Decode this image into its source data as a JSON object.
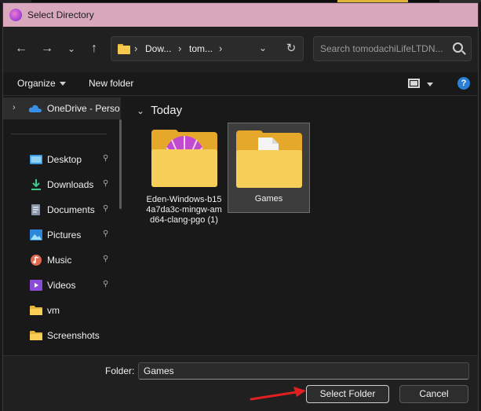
{
  "window": {
    "title": "Select Directory"
  },
  "nav": {
    "breadcrumb": [
      "Dow...",
      "tom..."
    ],
    "search_placeholder": "Search tomodachiLifeLTDN..."
  },
  "toolbar": {
    "organize": "Organize",
    "new_folder": "New folder",
    "help": "?"
  },
  "sidebar": {
    "items": [
      {
        "label": "OneDrive - Perso",
        "icon": "cloud-icon"
      },
      {
        "label": "Desktop",
        "icon": "desktop-icon",
        "pinned": true
      },
      {
        "label": "Downloads",
        "icon": "download-icon",
        "pinned": true
      },
      {
        "label": "Documents",
        "icon": "document-icon",
        "pinned": true
      },
      {
        "label": "Pictures",
        "icon": "picture-icon",
        "pinned": true
      },
      {
        "label": "Music",
        "icon": "music-icon",
        "pinned": true
      },
      {
        "label": "Videos",
        "icon": "video-icon",
        "pinned": true
      },
      {
        "label": "vm",
        "icon": "folder-icon"
      },
      {
        "label": "Screenshots",
        "icon": "folder-icon"
      }
    ]
  },
  "content": {
    "group": "Today",
    "items": [
      {
        "name": "Eden-Windows-b154a7da3c-mingw-amd64-clang-pgo (1)",
        "selected": false
      },
      {
        "name": "Games",
        "selected": true
      }
    ]
  },
  "footer": {
    "folder_label": "Folder:",
    "folder_value": "Games",
    "select_button": "Select Folder",
    "cancel_button": "Cancel"
  },
  "colors": {
    "titlebar": "#d9a8bc",
    "folder_yellow": "#f7cf58",
    "arrow_red": "#e02020"
  }
}
